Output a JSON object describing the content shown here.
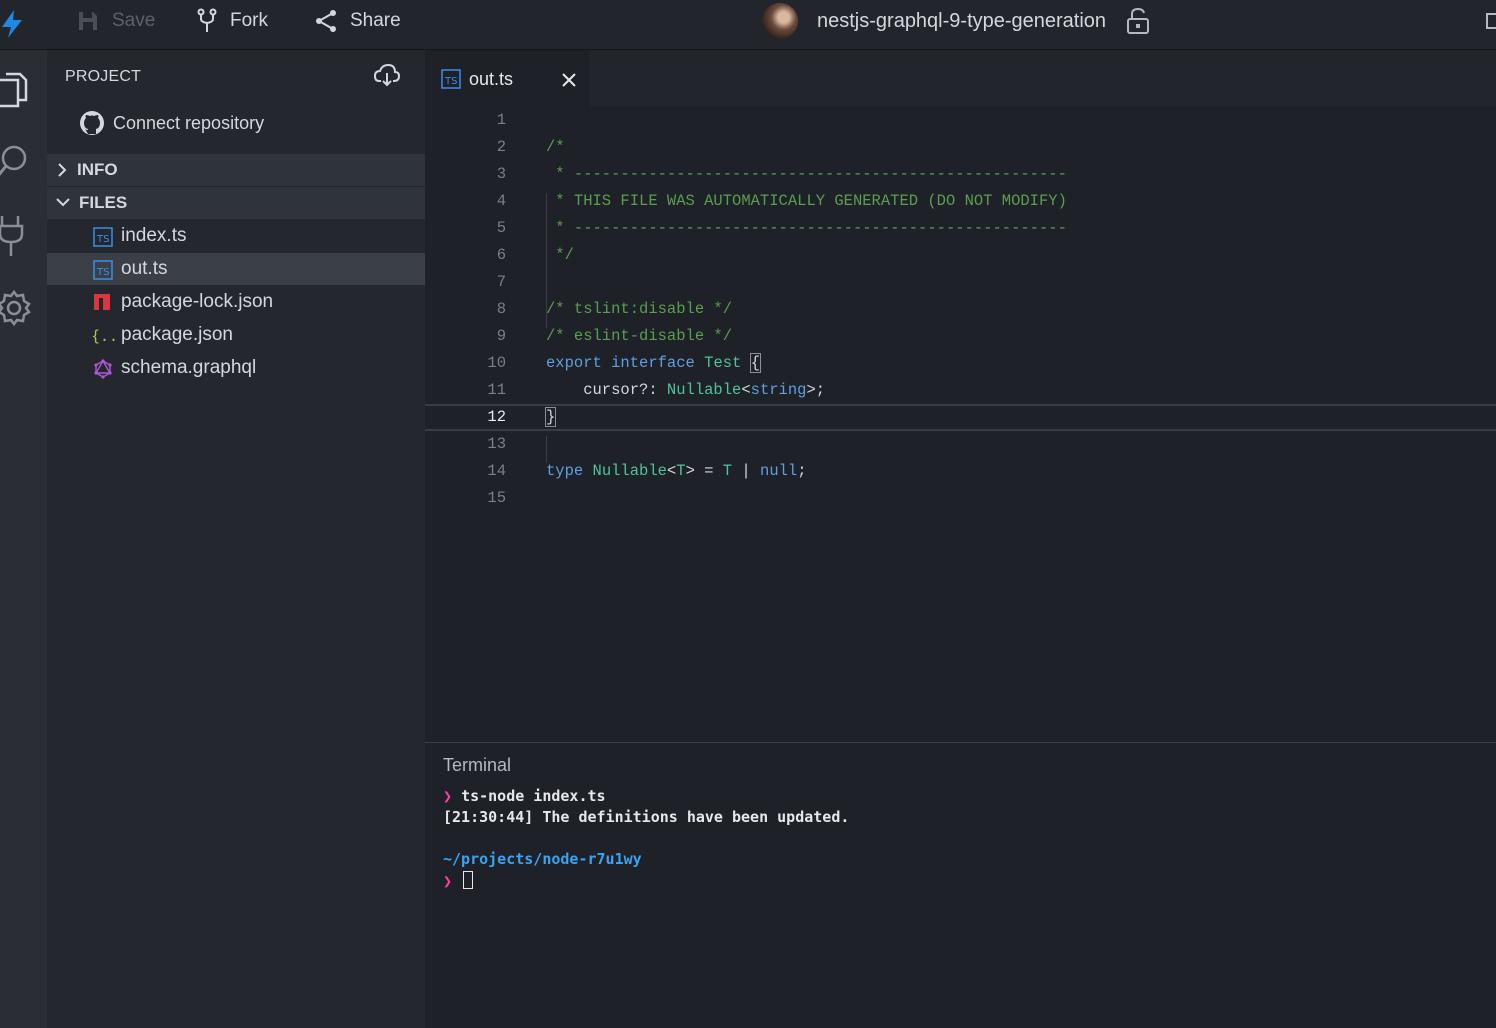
{
  "topbar": {
    "save_label": "Save",
    "fork_label": "Fork",
    "share_label": "Share",
    "project_title": "nestjs-graphql-9-type-generation"
  },
  "sidebar": {
    "project_header": "PROJECT",
    "connect_label": "Connect repository",
    "info_label": "INFO",
    "files_label": "FILES",
    "files": [
      {
        "name": "index.ts",
        "icon": "typescript-icon"
      },
      {
        "name": "out.ts",
        "icon": "typescript-icon"
      },
      {
        "name": "package-lock.json",
        "icon": "npm-icon"
      },
      {
        "name": "package.json",
        "icon": "json-icon"
      },
      {
        "name": "schema.graphql",
        "icon": "graphql-icon"
      }
    ],
    "selected_file": "out.ts"
  },
  "editor": {
    "tab_label": "out.ts",
    "active_line": 12,
    "lines": [
      "",
      "/*",
      " * -----------------------------------------------------",
      " * THIS FILE WAS AUTOMATICALLY GENERATED (DO NOT MODIFY)",
      " * -----------------------------------------------------",
      " */",
      "",
      "/* tslint:disable */",
      "/* eslint-disable */",
      "export interface Test {",
      "    cursor?: Nullable<string>;",
      "}",
      "",
      "type Nullable<T> = T | null;",
      ""
    ]
  },
  "terminal": {
    "title": "Terminal",
    "prompt_symbol": "❯",
    "command": "ts-node index.ts",
    "output": "[21:30:44] The definitions have been updated.",
    "cwd": "~/projects/node-r7u1wy"
  },
  "colors": {
    "accent": "#3aa3f3",
    "comment": "#5a9e50",
    "keyword": "#5f9fe0",
    "type": "#4fc1a0",
    "prompt": "#ff3fa4"
  }
}
